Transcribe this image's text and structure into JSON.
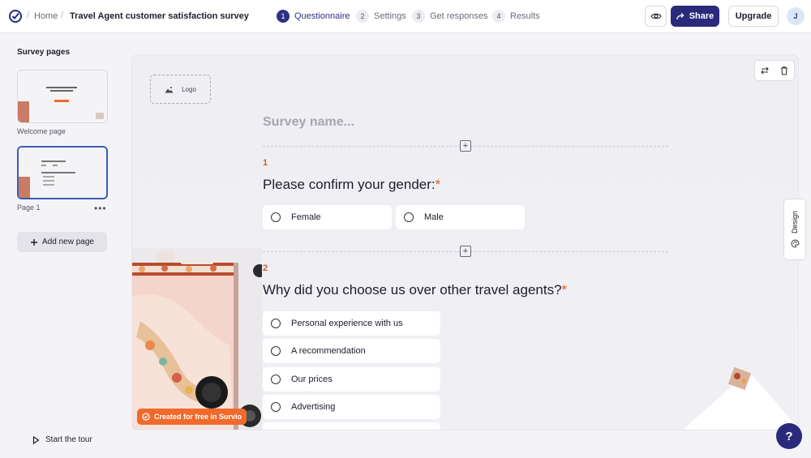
{
  "header": {
    "breadcrumb_home": "Home",
    "survey_title": "Travel Agent customer satisfaction survey",
    "steps": [
      {
        "num": "1",
        "label": "Questionnaire",
        "active": true
      },
      {
        "num": "2",
        "label": "Settings"
      },
      {
        "num": "3",
        "label": "Get responses"
      },
      {
        "num": "4",
        "label": "Results"
      }
    ],
    "share_label": "Share",
    "upgrade_label": "Upgrade",
    "avatar_initial": "J"
  },
  "sidebar": {
    "title": "Survey pages",
    "pages": [
      {
        "label": "Welcome page"
      },
      {
        "label": "Page 1"
      }
    ],
    "more_label": "•••",
    "add_page_label": "Add new page",
    "tour_label": "Start the tour"
  },
  "canvas": {
    "logo_label": "Logo",
    "survey_name_placeholder": "Survey name...",
    "questions": [
      {
        "num": "1",
        "text": "Please confirm your gender:",
        "required": "*",
        "options": [
          "Female",
          "Male"
        ]
      },
      {
        "num": "2",
        "text": "Why did you choose us over other travel agents?",
        "required": "*",
        "options": [
          "Personal experience with us",
          "A recommendation",
          "Our prices",
          "Advertising"
        ]
      }
    ],
    "badge_label": "Created for free in Survio",
    "design_tab_label": "Design",
    "help_label": "?"
  },
  "colors": {
    "primary": "#2a2a7d",
    "accent_orange": "#f06a2c",
    "required": "#e05a1e",
    "question_number": "#c9642a"
  }
}
